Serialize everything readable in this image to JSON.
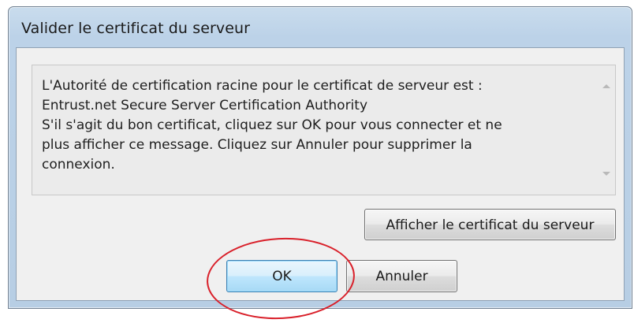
{
  "dialog": {
    "title": "Valider le certificat du serveur",
    "message_lines": [
      "L'Autorité de certification racine pour le certificat de serveur est :",
      "Entrust.net Secure Server Certification Authority",
      "S'il s'agit du bon certificat, cliquez sur OK pour vous connecter et ne",
      "plus afficher ce message. Cliquez sur Annuler pour supprimer la",
      "connexion."
    ],
    "buttons": {
      "view_certificate": "Afficher le certificat du serveur",
      "ok": "OK",
      "cancel": "Annuler"
    }
  },
  "annotation": {
    "highlight_color": "#d9202a",
    "highlight_target": "ok-button"
  }
}
